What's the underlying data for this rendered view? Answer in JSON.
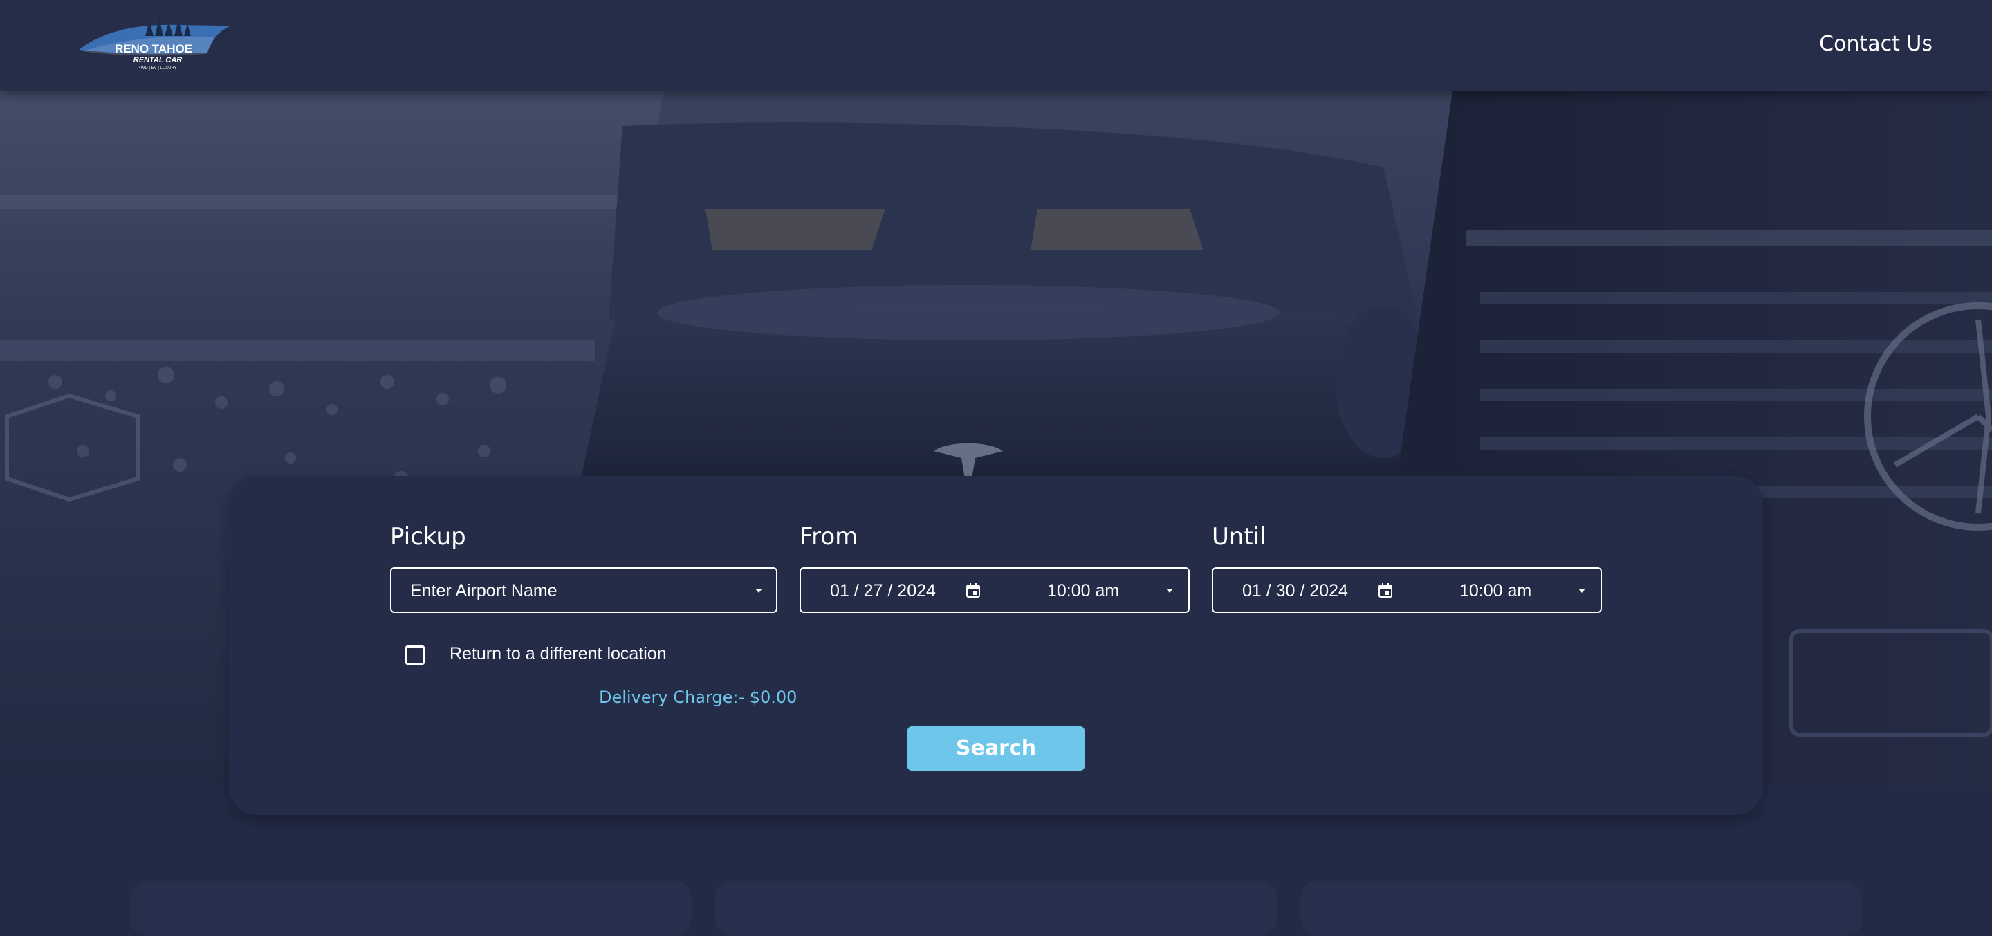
{
  "header": {
    "logo": {
      "line1": "RENO TAHOE",
      "line2": "RENTAL CAR",
      "line3": "4WD | EV | LUXURY"
    },
    "contact_label": "Contact Us"
  },
  "search": {
    "pickup": {
      "label": "Pickup",
      "placeholder": "Enter Airport Name"
    },
    "from": {
      "label": "From",
      "date": "01 / 27 / 2024",
      "time": "10:00 am"
    },
    "until": {
      "label": "Until",
      "date": "01 / 30 / 2024",
      "time": "10:00 am"
    },
    "return_label": "Return to a different location",
    "delivery_charge": "Delivery Charge:- $0.00",
    "search_label": "Search"
  },
  "colors": {
    "background": "#222a45",
    "header": "#252d48",
    "panel": "#242c48",
    "accent": "#6ec6ea"
  },
  "icons": [
    "calendar-icon",
    "chevron-down-icon",
    "checkbox-icon"
  ]
}
